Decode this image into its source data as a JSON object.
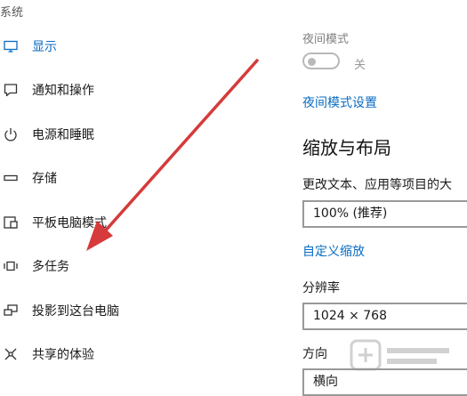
{
  "left_panel": {
    "section_title": "系统",
    "items": [
      {
        "label": "显示",
        "icon": "monitor-icon",
        "active": true
      },
      {
        "label": "通知和操作",
        "icon": "notification-icon"
      },
      {
        "label": "电源和睡眠",
        "icon": "power-icon"
      },
      {
        "label": "存储",
        "icon": "storage-icon"
      },
      {
        "label": "平板电脑模式",
        "icon": "tablet-mode-icon"
      },
      {
        "label": "多任务",
        "icon": "multitasking-icon"
      },
      {
        "label": "投影到这台电脑",
        "icon": "project-icon"
      },
      {
        "label": "共享的体验",
        "icon": "shared-experience-icon"
      }
    ]
  },
  "content": {
    "night_mode": {
      "label": "夜间模式",
      "toggle_state": "关",
      "toggle_on": false
    },
    "night_mode_settings_link": "夜间模式设置",
    "scale_layout_heading": "缩放与布局",
    "scale_label": "更改文本、应用等项目的大",
    "scale_value": "100% (推荐)",
    "custom_scale_link": "自定义缩放",
    "resolution_label": "分辨率",
    "resolution_value": "1024 × 768",
    "orientation_label": "方向",
    "orientation_value": "横向"
  },
  "colors": {
    "accent": "#0a6cc2",
    "arrow": "#d63a3a",
    "text": "#1a1a1a"
  }
}
